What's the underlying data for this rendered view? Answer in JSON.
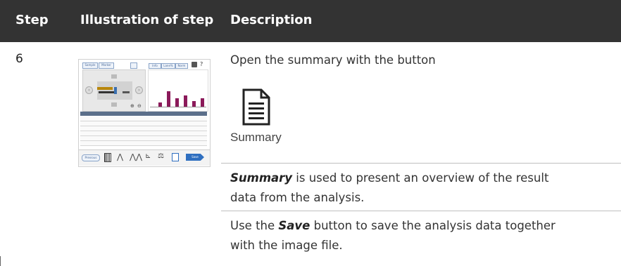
{
  "header": {
    "col_step": "Step",
    "col_illustration": "Illustration of step",
    "col_description": "Description"
  },
  "row": {
    "step": "6",
    "intro": "Open the summary with the button",
    "button_label": "Summary",
    "p1_bold": "Summary",
    "p1_line1_rest": " is used to present an overview of the result",
    "p1_line2": "data from the analysis.",
    "p2_pre": "Use the ",
    "p2_bold": "Save",
    "p2_line1_rest": " button to save the analysis data together",
    "p2_line2": "with the image file."
  },
  "thumbnail": {
    "button_left1": "Sample",
    "button_left2": "Marker",
    "tab1": "Info",
    "tab2": "Lane%",
    "tab3": "Norm",
    "previous": "Previous",
    "save": "Save"
  },
  "colors": {
    "header_bg": "#333333",
    "bar": "#8b1a5a",
    "save_button": "#2f6fc0"
  }
}
